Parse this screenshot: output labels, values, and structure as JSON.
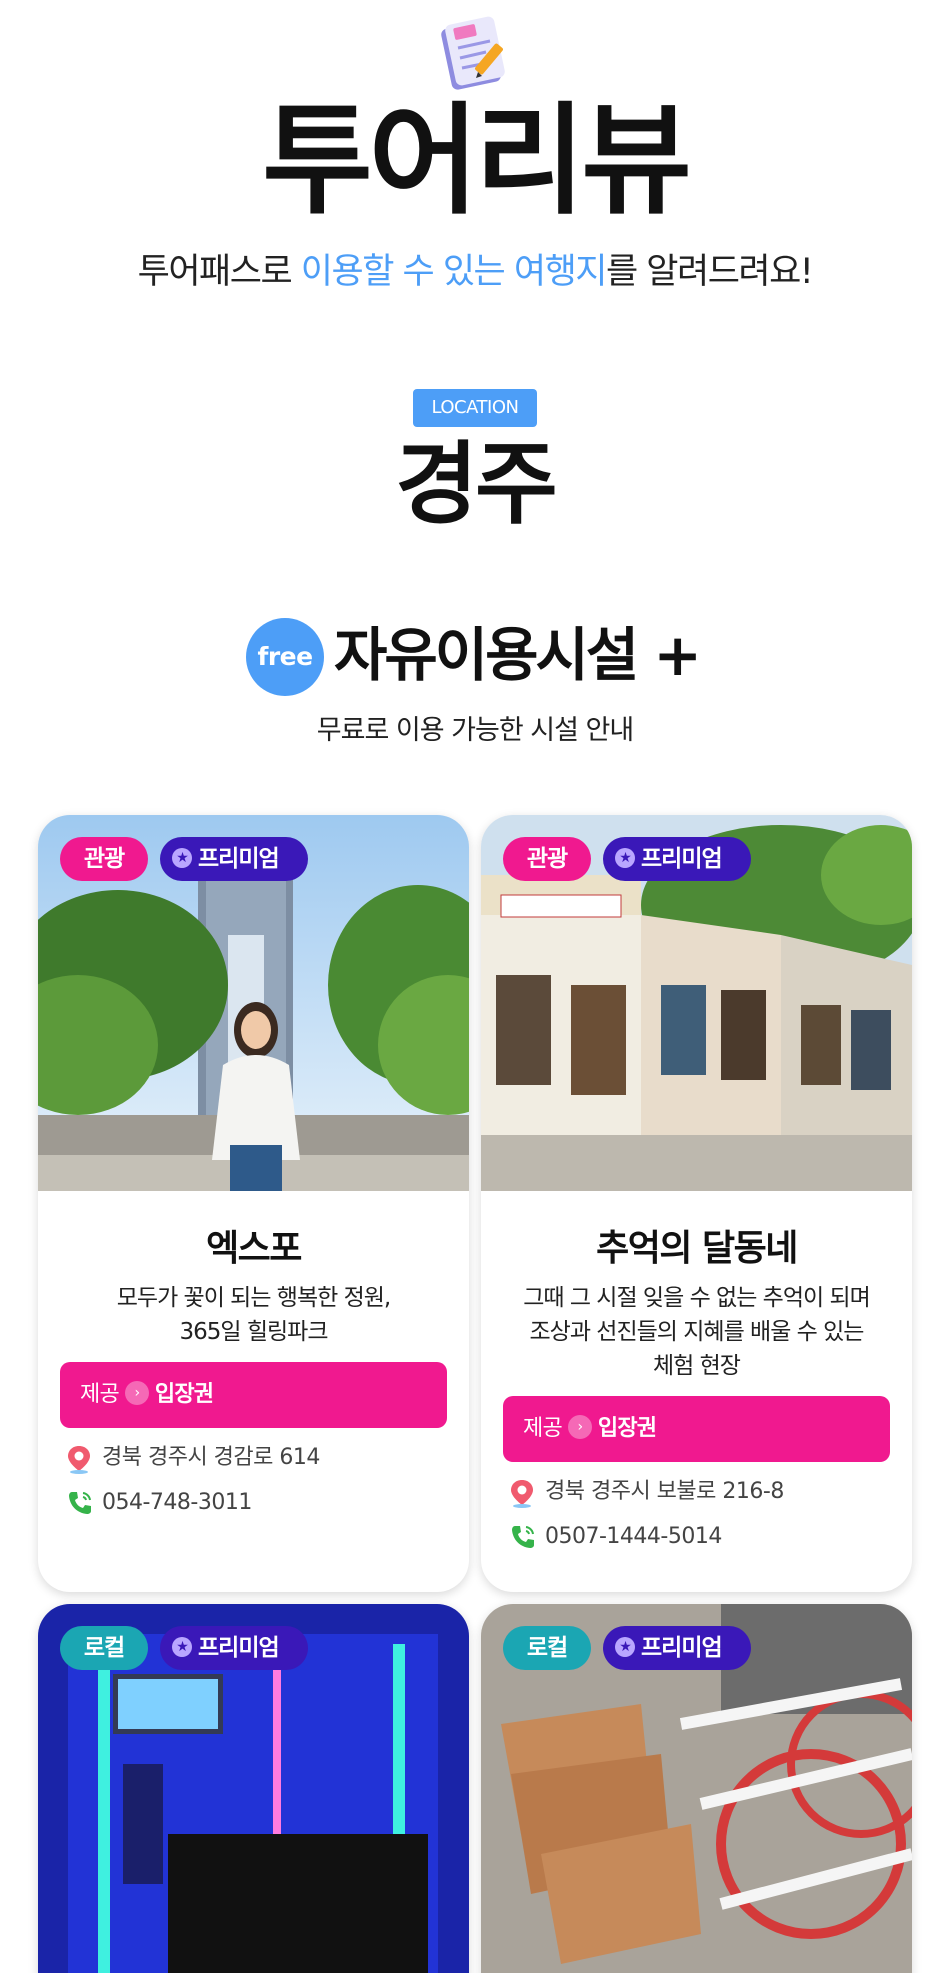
{
  "header": {
    "title": "투어리뷰",
    "subtitle_pre": "투어패스로 ",
    "subtitle_highlight": "이용할 수 있는 여행지",
    "subtitle_post": "를 알려드려요!"
  },
  "location": {
    "badge": "LOCATION",
    "city": "경주"
  },
  "section": {
    "free_badge": "free",
    "title": "자유이용시설 +",
    "subtitle": "무료로 이용 가능한 시설 안내"
  },
  "cards": [
    {
      "category": "관광",
      "premium": "프리미엄",
      "name": "엑스포",
      "desc_line1": "모두가 꽃이 되는 행복한 정원,",
      "desc_line2": "365일 힐링파크",
      "desc_line3": "",
      "provide_label": "제공",
      "provide_item": "입장권",
      "address": "경북 경주시 경감로 614",
      "phone": "054-748-3011"
    },
    {
      "category": "관광",
      "premium": "프리미엄",
      "name": "추억의 달동네",
      "desc_line1": "그때 그 시절 잊을 수 없는 추억이 되며",
      "desc_line2": "조상과 선진들의 지혜를 배울 수 있는",
      "desc_line3": "체험 현장",
      "provide_label": "제공",
      "provide_item": "입장권",
      "address": "경북 경주시 보불로 216-8",
      "phone": "0507-1444-5014"
    },
    {
      "category": "로컬",
      "premium": "프리미엄"
    },
    {
      "category": "로컬",
      "premium": "프리미엄"
    }
  ],
  "colors": {
    "accent_blue": "#4d9ef7",
    "pink": "#f0198f",
    "teal": "#1ba6b3",
    "premium_purple": "#3a18b8"
  },
  "icons": [
    "memo-pencil-icon",
    "star-icon",
    "arrow-right-icon",
    "location-pin-icon",
    "phone-icon"
  ]
}
